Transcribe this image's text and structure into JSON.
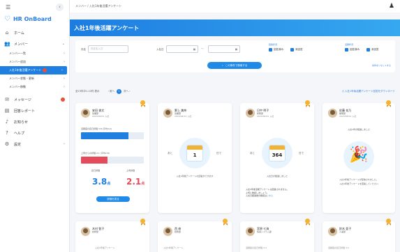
{
  "app": {
    "name": "HR OnBoard"
  },
  "breadcrumb": "メンバー / 入社1年後活躍アンケート",
  "page_title": "入社1年後活躍アンケート",
  "sidebar": {
    "items": [
      {
        "label": "ホーム",
        "icon": "home-icon"
      },
      {
        "label": "メンバー",
        "icon": "users-icon"
      },
      {
        "label": "メッセージ",
        "icon": "message-icon"
      },
      {
        "label": "回答レポート",
        "icon": "report-icon"
      },
      {
        "label": "お知らせ",
        "icon": "bell-icon"
      },
      {
        "label": "ヘルプ",
        "icon": "help-icon"
      },
      {
        "label": "設定",
        "icon": "gear-icon"
      }
    ],
    "subitems": [
      "メンバー一覧",
      "メンバー追加",
      "入社1年後活躍アンケート",
      "メンバー状態・更新",
      "メンバー移動"
    ]
  },
  "filter": {
    "name_label": "氏名",
    "name_placeholder": "氏名を入力",
    "date_label": "入社日",
    "group1_label": "回答状況",
    "group2_label": "活躍状況",
    "opt_answered": "回答済み",
    "opt_unanswered": "未回答",
    "search_label": "この条件で検索する",
    "clear_label": "条件をリセットする"
  },
  "toolbar": {
    "range_text": "全23件中1-10件 表示",
    "prev": "前へ",
    "page": "1",
    "next": "次へ",
    "download": "入社1年後活躍アンケート回答をダウンロード"
  },
  "cards": [
    {
      "name": "安田 俊文",
      "dept": "営業部",
      "sub": "2023/04/01 入社",
      "stat1_label": "活躍度の自己評価 3.8 (平均3.2)",
      "stat2_label": "上司からの評価 2.1 (平均2.8)",
      "score_self_label": "自己評価",
      "score_boss_label": "上司評価",
      "score_self": "3.8",
      "score_boss": "2.1",
      "score_unit": "点",
      "button": "詳細を見る",
      "fill1": 0.76,
      "fill2": 0.42
    },
    {
      "name": "野上 美奈",
      "dept": "営業部",
      "sub": "2023/04/01 入社",
      "days": "1",
      "days_left": "あと",
      "days_right": "日で",
      "msg": "入社1年後アンケートの回答ができます"
    },
    {
      "name": "日中 明子",
      "dept": "総務部",
      "sub": "2023/04/01 入社",
      "days": "364",
      "days_left": "あと",
      "days_right": "日で",
      "msg": "入社日が経過しました",
      "notice1": "入社1年後活躍アンケートは回答されません。",
      "notice2": "上司に確認しましょう。",
      "notice3": "入社日経過後の確認は",
      "notice_link": "こちら"
    },
    {
      "name": "佐藤 花乃",
      "dept": "開発部",
      "sub": "2023/04/01 入社",
      "msg_top": "入社1年が経過しました",
      "msg1": "入社1年後アンケートが配信されました。",
      "msg2": "入社1年後アンケートを回答してください"
    }
  ],
  "cards_bottom": [
    {
      "name": "木村 智子",
      "dept": "総務部",
      "sub": "入社1年後アンケート"
    },
    {
      "name": "西 修",
      "dept": "総務部",
      "sub": "入社1年後アンケート"
    },
    {
      "name": "宮原 七海",
      "dept": "情報システム部",
      "sub": "活躍度の自己評価 3.3"
    },
    {
      "name": "鈴木 亜子",
      "dept": "人事部",
      "sub": "活躍度の自己評価 3.3"
    }
  ],
  "colors": {
    "primary": "#1f7fe0",
    "red": "#e64b5b",
    "ribbon": "#f2b232"
  }
}
